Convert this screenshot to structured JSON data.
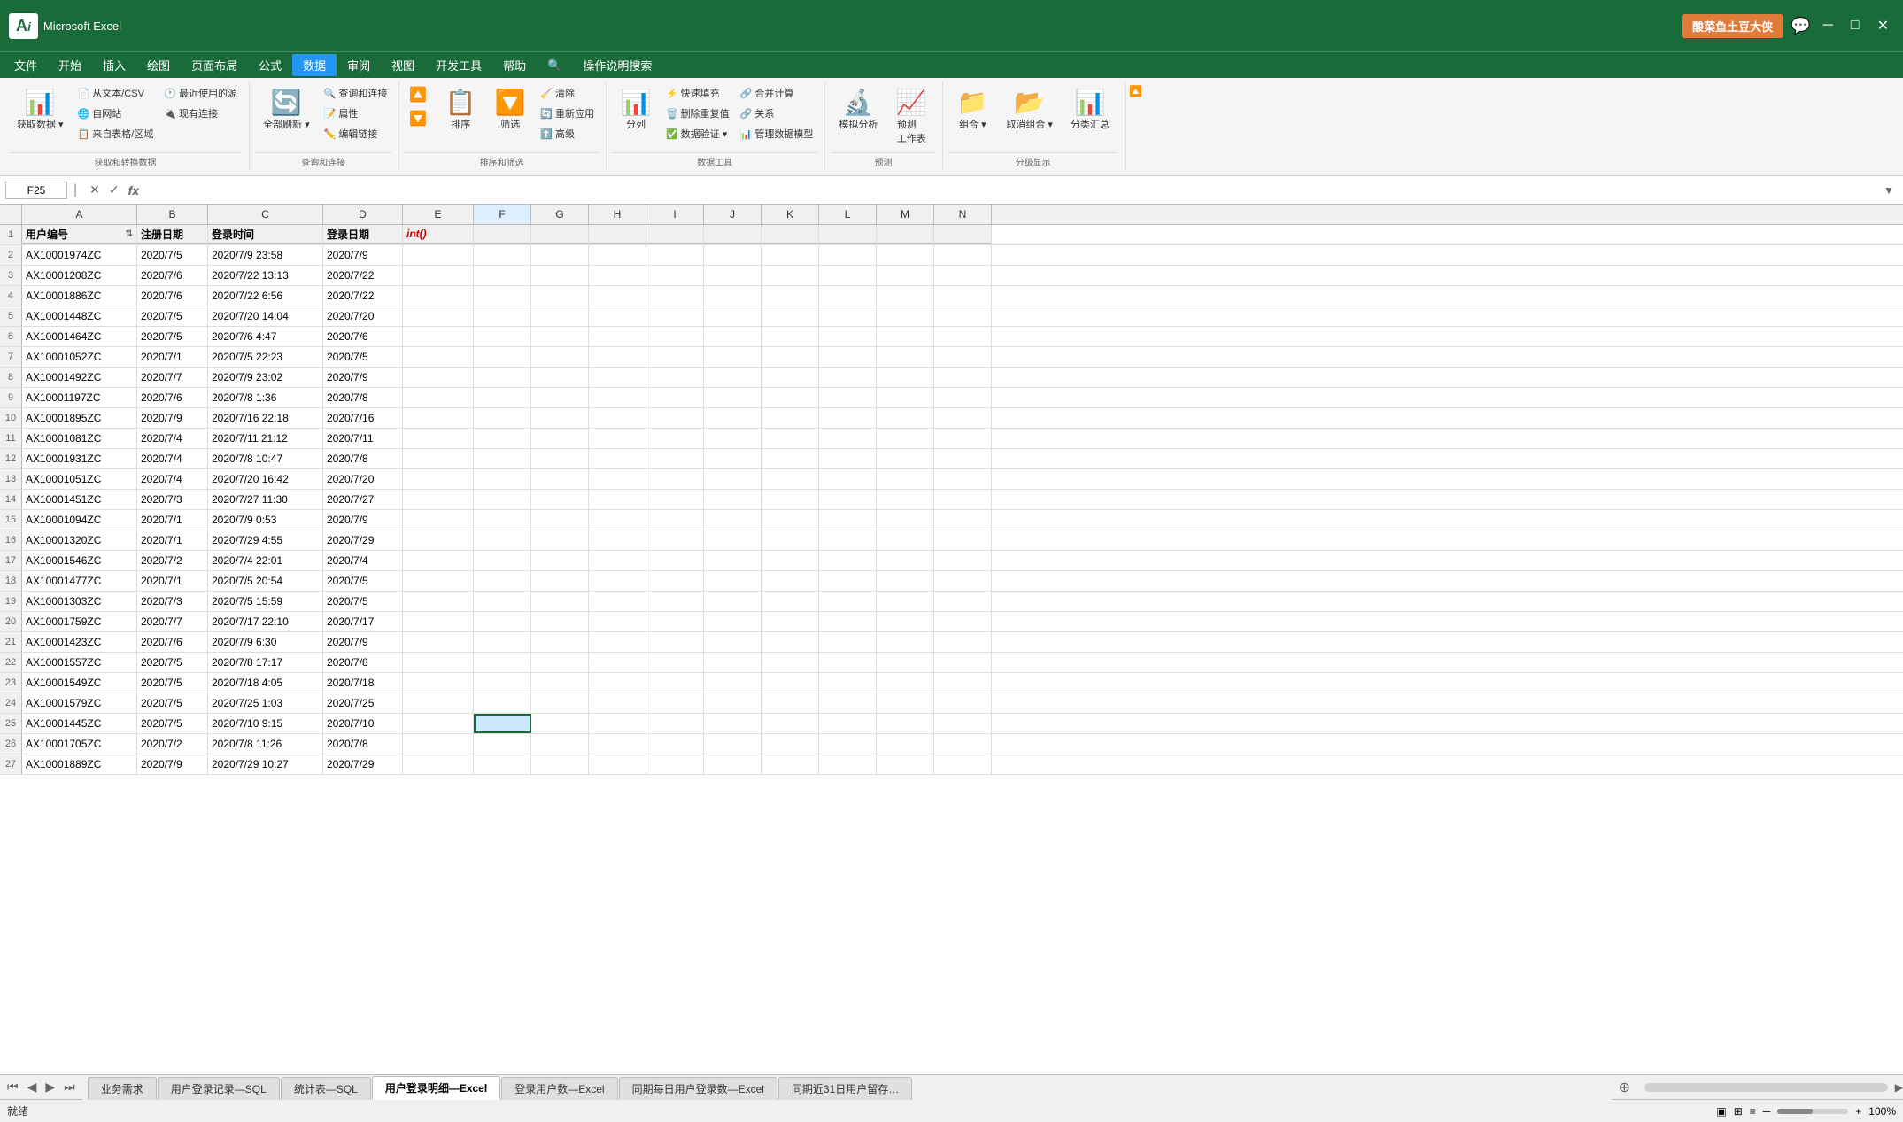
{
  "titlebar": {
    "username": "酸菜鱼土豆大侠",
    "chat_icon": "💬"
  },
  "menu": {
    "items": [
      "文件",
      "开始",
      "插入",
      "绘图",
      "页面布局",
      "公式",
      "数据",
      "审阅",
      "视图",
      "开发工具",
      "帮助",
      "🔍",
      "操作说明搜索"
    ]
  },
  "ribbon": {
    "groups": [
      {
        "label": "获取和转换数据",
        "buttons": [
          {
            "icon": "📊",
            "label": "获取数据",
            "type": "big",
            "dropdown": true
          },
          {
            "icon": "📄",
            "label": "从文本/CSV",
            "type": "small"
          },
          {
            "icon": "🌐",
            "label": "自网站",
            "type": "small"
          },
          {
            "icon": "📋",
            "label": "来自表格/区域",
            "type": "small"
          },
          {
            "icon": "🔗",
            "label": "最近使用的源",
            "type": "small"
          },
          {
            "icon": "🔌",
            "label": "现有连接",
            "type": "small"
          }
        ]
      },
      {
        "label": "查询和连接",
        "buttons": [
          {
            "icon": "🔄",
            "label": "全部刷新",
            "type": "big",
            "dropdown": true
          },
          {
            "icon": "🔍",
            "label": "查询和连接",
            "type": "small"
          },
          {
            "icon": "📝",
            "label": "属性",
            "type": "small"
          },
          {
            "icon": "✏️",
            "label": "编辑链接",
            "type": "small"
          }
        ]
      },
      {
        "label": "排序和筛选",
        "buttons": [
          {
            "icon": "🔼",
            "label": "",
            "type": "sort"
          },
          {
            "icon": "🔽",
            "label": "",
            "type": "sort"
          },
          {
            "icon": "🔤",
            "label": "排序",
            "type": "big"
          },
          {
            "icon": "🔽",
            "label": "筛选",
            "type": "big"
          },
          {
            "icon": "🧹",
            "label": "清除",
            "type": "small"
          },
          {
            "icon": "🔄",
            "label": "重新应用",
            "type": "small"
          },
          {
            "icon": "⬆️",
            "label": "高级",
            "type": "small"
          }
        ]
      },
      {
        "label": "数据工具",
        "buttons": [
          {
            "icon": "📊",
            "label": "分列",
            "type": "big"
          },
          {
            "icon": "⚡",
            "label": "快速填充",
            "type": "small"
          },
          {
            "icon": "🗑️",
            "label": "删除重复值",
            "type": "small"
          },
          {
            "icon": "✅",
            "label": "数据验证",
            "type": "small",
            "dropdown": true
          },
          {
            "icon": "🔗",
            "label": "合并计算",
            "type": "small"
          },
          {
            "icon": "🔗",
            "label": "关系",
            "type": "small"
          },
          {
            "icon": "📊",
            "label": "管理数据模型",
            "type": "small"
          }
        ]
      },
      {
        "label": "预测",
        "buttons": [
          {
            "icon": "🔬",
            "label": "模拟分析",
            "type": "big"
          },
          {
            "icon": "📈",
            "label": "预测工作表",
            "type": "big"
          }
        ]
      },
      {
        "label": "分级显示",
        "buttons": [
          {
            "icon": "📁",
            "label": "组合",
            "type": "big",
            "dropdown": true
          },
          {
            "icon": "📂",
            "label": "取消组合",
            "type": "big",
            "dropdown": true
          },
          {
            "icon": "📊",
            "label": "分类汇总",
            "type": "big"
          }
        ]
      }
    ]
  },
  "formula_bar": {
    "cell_ref": "F25",
    "formula": ""
  },
  "columns": {
    "row_num_width": 25,
    "headers": [
      "A",
      "B",
      "C",
      "D",
      "E",
      "F",
      "G",
      "H",
      "I",
      "J",
      "K",
      "L",
      "M",
      "N"
    ]
  },
  "header_row": {
    "a": "用户编号",
    "b": "注册日期",
    "c": "登录时间",
    "d": "登录日期",
    "e": "int()",
    "f": "",
    "g": "",
    "h": "",
    "i": "",
    "j": "",
    "k": "",
    "l": "",
    "m": "",
    "n": ""
  },
  "rows": [
    {
      "num": 2,
      "a": "AX10001974ZC",
      "b": "2020/7/5",
      "c": "2020/7/9 23:58",
      "d": "2020/7/9",
      "e": ""
    },
    {
      "num": 3,
      "a": "AX10001208ZC",
      "b": "2020/7/6",
      "c": "2020/7/22 13:13",
      "d": "2020/7/22",
      "e": ""
    },
    {
      "num": 4,
      "a": "AX10001886ZC",
      "b": "2020/7/6",
      "c": "2020/7/22 6:56",
      "d": "2020/7/22",
      "e": ""
    },
    {
      "num": 5,
      "a": "AX10001448ZC",
      "b": "2020/7/5",
      "c": "2020/7/20 14:04",
      "d": "2020/7/20",
      "e": ""
    },
    {
      "num": 6,
      "a": "AX10001464ZC",
      "b": "2020/7/5",
      "c": "2020/7/6 4:47",
      "d": "2020/7/6",
      "e": ""
    },
    {
      "num": 7,
      "a": "AX10001052ZC",
      "b": "2020/7/1",
      "c": "2020/7/5 22:23",
      "d": "2020/7/5",
      "e": ""
    },
    {
      "num": 8,
      "a": "AX10001492ZC",
      "b": "2020/7/7",
      "c": "2020/7/9 23:02",
      "d": "2020/7/9",
      "e": ""
    },
    {
      "num": 9,
      "a": "AX10001197ZC",
      "b": "2020/7/6",
      "c": "2020/7/8 1:36",
      "d": "2020/7/8",
      "e": ""
    },
    {
      "num": 10,
      "a": "AX10001895ZC",
      "b": "2020/7/9",
      "c": "2020/7/16 22:18",
      "d": "2020/7/16",
      "e": ""
    },
    {
      "num": 11,
      "a": "AX10001081ZC",
      "b": "2020/7/4",
      "c": "2020/7/11 21:12",
      "d": "2020/7/11",
      "e": ""
    },
    {
      "num": 12,
      "a": "AX10001931ZC",
      "b": "2020/7/4",
      "c": "2020/7/8 10:47",
      "d": "2020/7/8",
      "e": ""
    },
    {
      "num": 13,
      "a": "AX10001051ZC",
      "b": "2020/7/4",
      "c": "2020/7/20 16:42",
      "d": "2020/7/20",
      "e": ""
    },
    {
      "num": 14,
      "a": "AX10001451ZC",
      "b": "2020/7/3",
      "c": "2020/7/27 11:30",
      "d": "2020/7/27",
      "e": ""
    },
    {
      "num": 15,
      "a": "AX10001094ZC",
      "b": "2020/7/1",
      "c": "2020/7/9 0:53",
      "d": "2020/7/9",
      "e": ""
    },
    {
      "num": 16,
      "a": "AX10001320ZC",
      "b": "2020/7/1",
      "c": "2020/7/29 4:55",
      "d": "2020/7/29",
      "e": ""
    },
    {
      "num": 17,
      "a": "AX10001546ZC",
      "b": "2020/7/2",
      "c": "2020/7/4 22:01",
      "d": "2020/7/4",
      "e": ""
    },
    {
      "num": 18,
      "a": "AX10001477ZC",
      "b": "2020/7/1",
      "c": "2020/7/5 20:54",
      "d": "2020/7/5",
      "e": ""
    },
    {
      "num": 19,
      "a": "AX10001303ZC",
      "b": "2020/7/3",
      "c": "2020/7/5 15:59",
      "d": "2020/7/5",
      "e": ""
    },
    {
      "num": 20,
      "a": "AX10001759ZC",
      "b": "2020/7/7",
      "c": "2020/7/17 22:10",
      "d": "2020/7/17",
      "e": ""
    },
    {
      "num": 21,
      "a": "AX10001423ZC",
      "b": "2020/7/6",
      "c": "2020/7/9 6:30",
      "d": "2020/7/9",
      "e": ""
    },
    {
      "num": 22,
      "a": "AX10001557ZC",
      "b": "2020/7/5",
      "c": "2020/7/8 17:17",
      "d": "2020/7/8",
      "e": ""
    },
    {
      "num": 23,
      "a": "AX10001549ZC",
      "b": "2020/7/5",
      "c": "2020/7/18 4:05",
      "d": "2020/7/18",
      "e": ""
    },
    {
      "num": 24,
      "a": "AX10001579ZC",
      "b": "2020/7/5",
      "c": "2020/7/25 1:03",
      "d": "2020/7/25",
      "e": ""
    },
    {
      "num": 25,
      "a": "AX10001445ZC",
      "b": "2020/7/5",
      "c": "2020/7/10 9:15",
      "d": "2020/7/10",
      "e": ""
    },
    {
      "num": 26,
      "a": "AX10001705ZC",
      "b": "2020/7/2",
      "c": "2020/7/8 11:26",
      "d": "2020/7/8",
      "e": ""
    },
    {
      "num": 27,
      "a": "AX10001889ZC",
      "b": "2020/7/9",
      "c": "2020/7/29 10:27",
      "d": "2020/7/29",
      "e": ""
    }
  ],
  "sheet_tabs": [
    {
      "label": "业务需求",
      "active": false
    },
    {
      "label": "用户登录记录—SQL",
      "active": false
    },
    {
      "label": "统计表—SQL",
      "active": false
    },
    {
      "label": "用户登录明细—Excel",
      "active": true
    },
    {
      "label": "登录用户数—Excel",
      "active": false
    },
    {
      "label": "同期每日用户登录数—Excel",
      "active": false
    },
    {
      "label": "同期近31日用户留存…",
      "active": false
    }
  ],
  "status_bar": {
    "items": []
  }
}
